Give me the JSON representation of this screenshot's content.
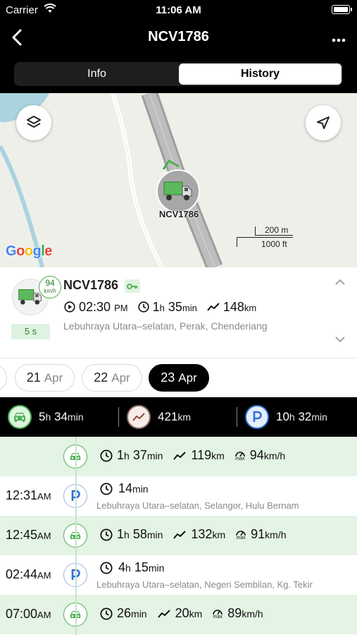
{
  "status_bar": {
    "carrier": "Carrier",
    "time": "11:06 AM"
  },
  "nav": {
    "title": "NCV1786"
  },
  "segments": [
    {
      "label": "Info",
      "selected": false
    },
    {
      "label": "History",
      "selected": true
    }
  ],
  "map": {
    "road_label": "Lebuhraya Utara–selatan",
    "marker_label": "NCV1786",
    "scale_top": "200 m",
    "scale_bottom": "1000 ft",
    "attribution": "Google"
  },
  "vehicle": {
    "plate": "NCV1786",
    "speed": "94",
    "speed_unit": "km/h",
    "age": "5 s",
    "time": "02:30",
    "time_suffix": "PM",
    "duration_h": "1",
    "duration_h_unit": "h",
    "duration_min": "35",
    "duration_min_unit": "min",
    "distance": "148",
    "distance_unit": "km",
    "address": "Lebuhraya Utara–selatan, Perak, Chenderiang"
  },
  "dates": [
    {
      "day": "21",
      "month": "Apr",
      "active": false
    },
    {
      "day": "22",
      "month": "Apr",
      "active": false
    },
    {
      "day": "23",
      "month": "Apr",
      "active": true
    }
  ],
  "summary": {
    "drive": {
      "h": "5",
      "h_unit": "h",
      "min": "34",
      "min_unit": "min"
    },
    "distance": {
      "value": "421",
      "unit": "km"
    },
    "park": {
      "h": "10",
      "h_unit": "h",
      "min": "32",
      "min_unit": "min"
    }
  },
  "timeline": [
    {
      "type": "drive",
      "time": "",
      "time_suffix": "",
      "dur_h": "1",
      "dur_min": "37",
      "distance": "119",
      "max_speed": "94"
    },
    {
      "type": "park",
      "time": "12:31",
      "time_suffix": "AM",
      "dur_h": "",
      "dur_min": "14",
      "address": "Lebuhraya Utara–selatan, Selangor, Hulu Bernam"
    },
    {
      "type": "drive",
      "time": "12:45",
      "time_suffix": "AM",
      "dur_h": "1",
      "dur_min": "58",
      "distance": "132",
      "max_speed": "91"
    },
    {
      "type": "park",
      "time": "02:44",
      "time_suffix": "AM",
      "dur_h": "4",
      "dur_min": "15",
      "address": "Lebuhraya Utara–selatan, Negeri Sembilan, Kg. Tekir"
    },
    {
      "type": "drive",
      "time": "07:00",
      "time_suffix": "AM",
      "dur_h": "",
      "dur_min": "26",
      "distance": "20",
      "max_speed": "89"
    }
  ],
  "units": {
    "h": "h",
    "min": "min",
    "km": "km",
    "kmh": "km/h",
    "max": "max"
  },
  "colors": {
    "green": "#4caf50",
    "park_blue": "#2f6fd8",
    "drive_row": "#e3f3e4",
    "summary_bg": "#000000"
  }
}
